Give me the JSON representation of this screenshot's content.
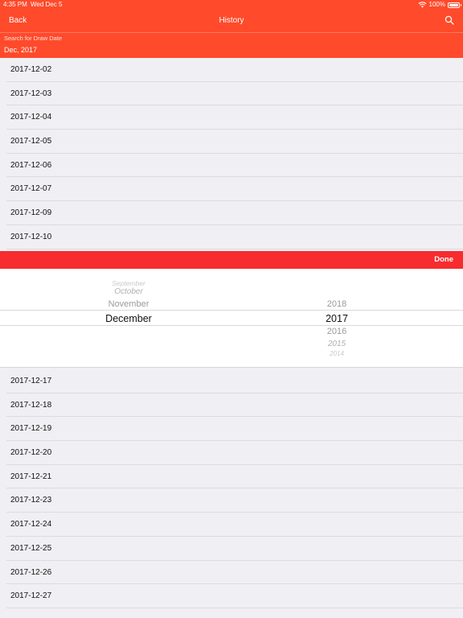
{
  "status_bar": {
    "time": "4:35 PM",
    "date": "Wed Dec 5",
    "battery": "100%",
    "battery_level": 1.0
  },
  "nav": {
    "back_label": "Back",
    "title": "History",
    "search_icon": "search-icon"
  },
  "search": {
    "label": "Search for Draw Date",
    "value": "Dec, 2017"
  },
  "colors": {
    "header": "#ff4a2b",
    "toolbar": "#f72c2f",
    "background": "#efeff4"
  },
  "list_top": [
    "2017-12-02",
    "2017-12-03",
    "2017-12-04",
    "2017-12-05",
    "2017-12-06",
    "2017-12-07",
    "2017-12-09",
    "2017-12-10"
  ],
  "toolbar": {
    "done_label": "Done"
  },
  "picker": {
    "months": [
      "September",
      "October",
      "November",
      "December"
    ],
    "selected_month": "December",
    "years": [
      "2018",
      "2017",
      "2016",
      "2015",
      "2014"
    ],
    "selected_year": "2017"
  },
  "list_bottom": [
    "2017-12-17",
    "2017-12-18",
    "2017-12-19",
    "2017-12-20",
    "2017-12-21",
    "2017-12-23",
    "2017-12-24",
    "2017-12-25",
    "2017-12-26",
    "2017-12-27"
  ]
}
